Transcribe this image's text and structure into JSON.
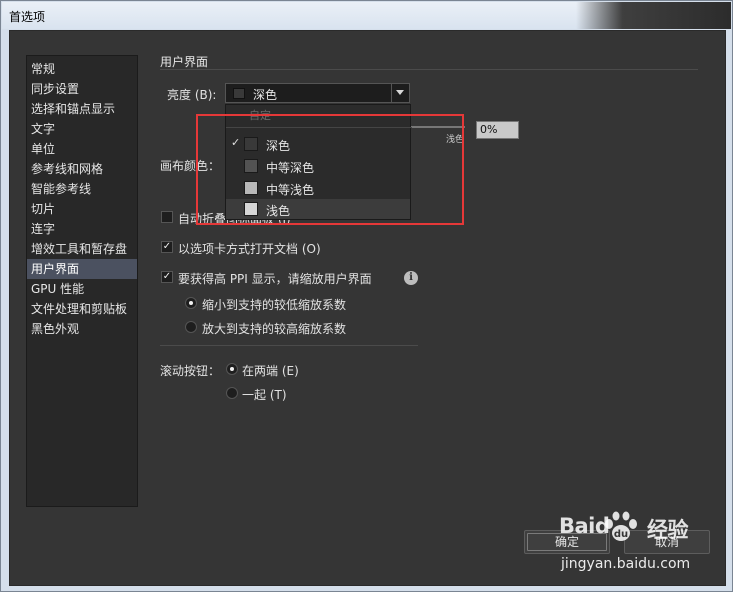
{
  "window": {
    "title": "首选项"
  },
  "sidebar": {
    "items": [
      {
        "label": "常规"
      },
      {
        "label": "同步设置"
      },
      {
        "label": "选择和锚点显示"
      },
      {
        "label": "文字"
      },
      {
        "label": "单位"
      },
      {
        "label": "参考线和网格"
      },
      {
        "label": "智能参考线"
      },
      {
        "label": "切片"
      },
      {
        "label": "连字"
      },
      {
        "label": "增效工具和暂存盘"
      },
      {
        "label": "用户界面"
      },
      {
        "label": "GPU 性能"
      },
      {
        "label": "文件处理和剪贴板"
      },
      {
        "label": "黑色外观"
      }
    ],
    "selected": "用户界面"
  },
  "panel": {
    "section_title": "用户界面",
    "brightness_label": "亮度 (B):",
    "brightness_value": "深色",
    "slider_end_label": "浅色",
    "percent_value": "0%",
    "canvas_color_label": "画布颜色：",
    "auto_collapse_label": "自动折叠图标面板 (I)",
    "open_as_tabs_label": "以选项卡方式打开文档 (O)",
    "high_ppi_label": "要获得高 PPI 显示，请缩放用户界面",
    "scale_down_label": "缩小到支持的较低缩放系数",
    "scale_up_label": "放大到支持的较高缩放系数",
    "scroll_buttons_label": "滚动按钮：",
    "at_both_ends_label": "在两端 (E)",
    "together_label": "一起 (T)"
  },
  "brightness_menu": {
    "header": "自定",
    "items": [
      {
        "label": "深色",
        "color": "#393939",
        "checked": true
      },
      {
        "label": "中等深色",
        "color": "#535353",
        "checked": false
      },
      {
        "label": "中等浅色",
        "color": "#b8b8b8",
        "checked": false
      },
      {
        "label": "浅色",
        "color": "#d6d6d6",
        "checked": false
      }
    ]
  },
  "states": {
    "auto_collapse": false,
    "open_as_tabs": true,
    "high_ppi": true,
    "scale_mode": "scale_down",
    "scroll_buttons": "at_both_ends"
  },
  "buttons": {
    "ok_label": "确定",
    "cancel_label": "取消"
  },
  "watermark": {
    "brand": "Baid",
    "brand_suffix": "经验",
    "url": "jingyan.baidu.com"
  },
  "colors": {
    "accent_highlight": "#e53838",
    "selected_item": "#4b5160"
  },
  "icons": {
    "info": "info-icon",
    "check": "checkmark-icon",
    "dropdown": "chevron-down-icon"
  }
}
